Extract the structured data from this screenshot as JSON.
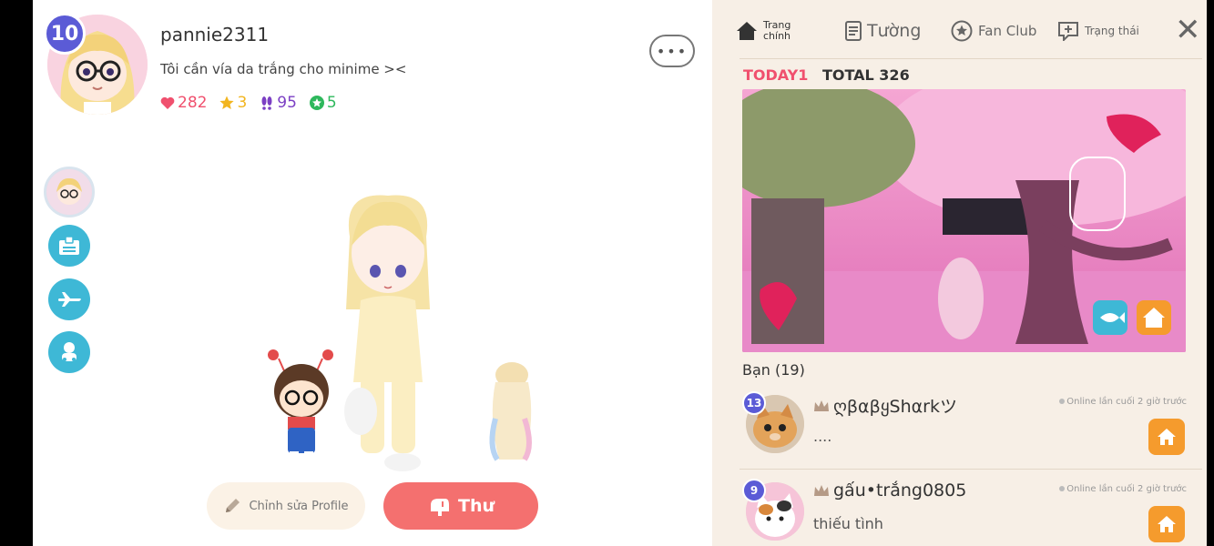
{
  "profile": {
    "level": "10",
    "username": "pannie2311",
    "bio": "Tôi cần vía da trắng cho minime ><",
    "stats": {
      "hearts": "282",
      "stars": "3",
      "footprints": "95",
      "clovers": "5"
    },
    "more_label": "•••"
  },
  "actions": {
    "edit_label": "Chỉnh sửa Profile",
    "mail_label": "Thư"
  },
  "right_panel": {
    "tabs": [
      {
        "label_line1": "Trang",
        "label_line2": "chính"
      },
      {
        "label": "Tường"
      },
      {
        "label": "Fan Club"
      },
      {
        "label": "Trạng thái"
      }
    ],
    "close_label": "✕",
    "today_label": "TODAY",
    "today_value": "1",
    "total_label": "TOTAL",
    "total_value": "326",
    "friends_title": "Bạn (19)",
    "friends": [
      {
        "level": "13",
        "name": "ღβαβყЅհαrkツ",
        "status": "Online lần cuối 2 giờ trước",
        "message": "...."
      },
      {
        "level": "9",
        "name": "gấu•trắng0805",
        "status": "Online lần cuối 2 giờ trước",
        "message": "thiếu tình"
      }
    ]
  },
  "colors": {
    "accent_pink": "#f4706f",
    "side_button": "#3eb8d6",
    "home_button": "#f59b2d",
    "level_badge": "#5b5bd6",
    "heart": "#f0506e",
    "star": "#f2b51f",
    "footprint": "#7b3fc4",
    "clover": "#2eb85c"
  }
}
